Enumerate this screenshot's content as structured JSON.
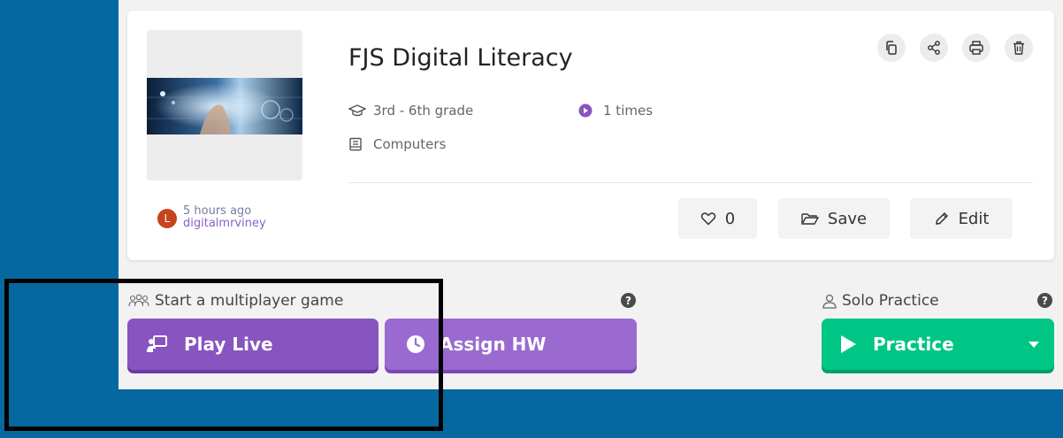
{
  "quiz": {
    "title": "FJS Digital Literacy",
    "grade": "3rd - 6th grade",
    "plays": "1 times",
    "subject": "Computers"
  },
  "author": {
    "avatar_letter": "L",
    "time_ago": "5 hours ago",
    "username": "digitalmrviney"
  },
  "actions": {
    "likes": "0",
    "save_label": "Save",
    "edit_label": "Edit"
  },
  "toolbar_icons": [
    "copy-icon",
    "share-icon",
    "print-icon",
    "trash-icon"
  ],
  "multiplayer": {
    "label": "Start a multiplayer game",
    "play_live_label": "Play Live",
    "assign_hw_label": "Assign HW"
  },
  "solo": {
    "label": "Solo Practice",
    "practice_label": "Practice"
  },
  "colors": {
    "background": "#0568a0",
    "purple": "#8854c0",
    "purple_light": "#9a6ad0",
    "green": "#00c584",
    "avatar": "#c8421c"
  }
}
